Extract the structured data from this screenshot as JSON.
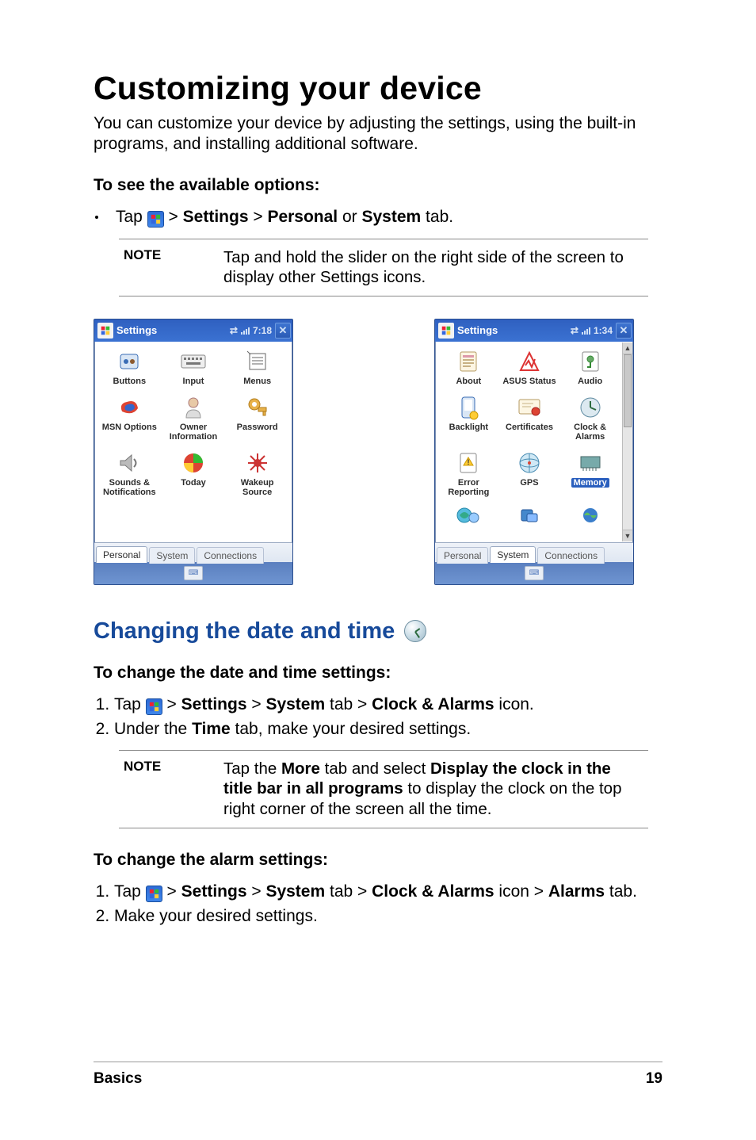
{
  "title": "Customizing your device",
  "intro": "You can customize your device by adjusting the settings, using the built-in programs, and installing additional software.",
  "avail_head": "To see the available options:",
  "avail_line_pre": "Tap",
  "avail_line_post1": " > ",
  "avail_line_settings": "Settings",
  "avail_line_post2": " > ",
  "avail_line_personal": "Personal",
  "avail_line_or": " or ",
  "avail_line_system": "System",
  "avail_line_end": " tab.",
  "note1_label": "NOTE",
  "note1_text": "Tap and hold the slider on the right side of the screen to display other Settings icons.",
  "wm1": {
    "title": "Settings",
    "time": "7:18",
    "tabs": [
      "Personal",
      "System",
      "Connections"
    ],
    "items": [
      "Buttons",
      "Input",
      "Menus",
      "MSN Options",
      "Owner Information",
      "Password",
      "Sounds & Notifications",
      "Today",
      "Wakeup Source"
    ]
  },
  "wm2": {
    "title": "Settings",
    "time": "1:34",
    "tabs": [
      "Personal",
      "System",
      "Connections"
    ],
    "items": [
      "About",
      "ASUS Status",
      "Audio",
      "Backlight",
      "Certificates",
      "Clock & Alarms",
      "Error Reporting",
      "GPS",
      "Memory"
    ],
    "selected_index": 8
  },
  "sub_heading": "Changing the date and time",
  "dt_head": "To change the date and time settings:",
  "dt_step1_pre": "Tap ",
  "dt_step1_a": "Settings",
  "dt_step1_b": "System",
  "dt_step1_b_suffix": " tab > ",
  "dt_step1_c": "Clock & Alarms",
  "dt_step1_end": " icon.",
  "dt_step2_a": "Under the ",
  "dt_step2_b": "Time",
  "dt_step2_c": " tab, make your desired settings.",
  "note2_label": "NOTE",
  "note2_pre": "Tap the ",
  "note2_more": "More",
  "note2_mid1": " tab and select ",
  "note2_bold": "Display the clock in the title bar in all programs",
  "note2_post": " to display the clock on the top right corner of the screen all the time.",
  "alarm_head": "To change the alarm settings:",
  "al_step1_pre": "Tap ",
  "al_step1_a": "Settings",
  "al_step1_b": "System",
  "al_step1_b_suffix": " tab > ",
  "al_step1_c": "Clock & Alarms",
  "al_step1_mid": " icon > ",
  "al_step1_d": "Alarms",
  "al_step1_end": " tab.",
  "al_step2": "Make your desired settings.",
  "footer_label": "Basics",
  "footer_page": "19"
}
